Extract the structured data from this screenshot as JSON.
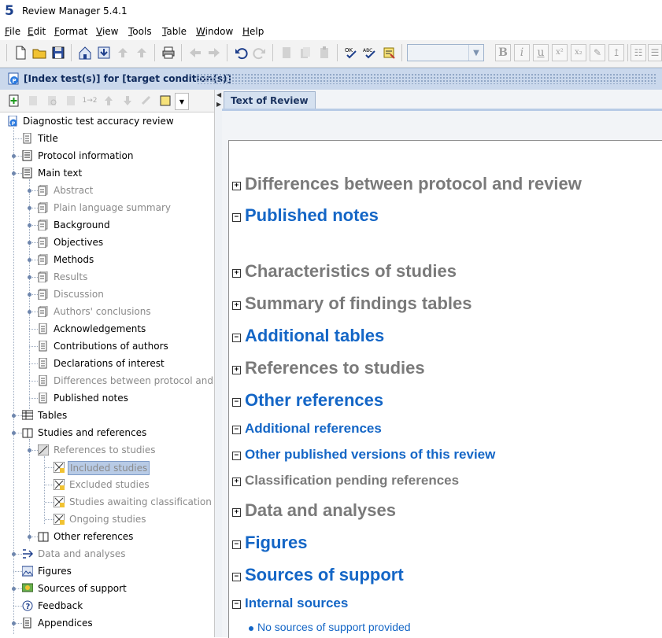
{
  "window": {
    "title": "Review Manager 5.4.1",
    "logo": "5"
  },
  "menu": [
    {
      "label": "File",
      "key": "F",
      "rest": "ile"
    },
    {
      "label": "Edit",
      "key": "E",
      "rest": "dit"
    },
    {
      "label": "Format",
      "key": "F",
      "rest": "ormat"
    },
    {
      "label": "View",
      "key": "V",
      "rest": "iew"
    },
    {
      "label": "Tools",
      "key": "T",
      "rest": "ools"
    },
    {
      "label": "Table",
      "key": "T",
      "rest": "able"
    },
    {
      "label": "Window",
      "key": "W",
      "rest": "indow"
    },
    {
      "label": "Help",
      "key": "H",
      "rest": "elp"
    }
  ],
  "toolbar": {
    "buttons": [
      "new-file-icon",
      "open-folder-icon",
      "save-icon",
      "home-icon",
      "download-icon",
      "upload-up-icon",
      "upload-icon",
      "print-icon",
      "back-arrow-icon",
      "forward-arrow-icon",
      "undo-icon",
      "redo-icon",
      "cut-icon",
      "copy-icon",
      "paste-icon",
      "spellcheck-ok-icon",
      "spellcheck-abc-icon",
      "notes-icon"
    ],
    "style_value": "",
    "format_buttons": [
      "B",
      "i",
      "u",
      "x²",
      "x₂",
      "✎",
      "↥"
    ]
  },
  "document": {
    "title": "[Index test(s)] for [target condition(s)]"
  },
  "tree": {
    "root": "Diagnostic test accuracy review",
    "items": [
      {
        "label": "Title",
        "dim": false
      },
      {
        "label": "Protocol information",
        "dim": false
      },
      {
        "label": "Main text",
        "dim": false
      },
      {
        "label": "Abstract",
        "dim": true
      },
      {
        "label": "Plain language summary",
        "dim": true
      },
      {
        "label": "Background",
        "dim": false
      },
      {
        "label": "Objectives",
        "dim": false
      },
      {
        "label": "Methods",
        "dim": false
      },
      {
        "label": "Results",
        "dim": true
      },
      {
        "label": "Discussion",
        "dim": true
      },
      {
        "label": "Authors' conclusions",
        "dim": true
      },
      {
        "label": "Acknowledgements",
        "dim": false
      },
      {
        "label": "Contributions of authors",
        "dim": false
      },
      {
        "label": "Declarations of interest",
        "dim": false
      },
      {
        "label": "Differences between protocol and review",
        "dim": true
      },
      {
        "label": "Published notes",
        "dim": false
      },
      {
        "label": "Tables",
        "dim": false
      },
      {
        "label": "Studies and references",
        "dim": false
      },
      {
        "label": "References to studies",
        "dim": true
      },
      {
        "label": "Included studies",
        "dim": true,
        "selected": true
      },
      {
        "label": "Excluded studies",
        "dim": true
      },
      {
        "label": "Studies awaiting classification",
        "dim": true
      },
      {
        "label": "Ongoing studies",
        "dim": true
      },
      {
        "label": "Other references",
        "dim": false
      },
      {
        "label": "Data and analyses",
        "dim": true
      },
      {
        "label": "Figures",
        "dim": false
      },
      {
        "label": "Sources of support",
        "dim": false
      },
      {
        "label": "Feedback",
        "dim": false
      },
      {
        "label": "Appendices",
        "dim": false
      }
    ]
  },
  "editor": {
    "tab": "Text of Review",
    "sections": [
      {
        "label": "Differences between protocol and review",
        "expanded": false,
        "size": "big",
        "active": false
      },
      {
        "label": "Published notes",
        "expanded": true,
        "size": "big",
        "active": true
      },
      {
        "label": "Characteristics of studies",
        "expanded": false,
        "size": "big",
        "active": false
      },
      {
        "label": "Summary of findings tables",
        "expanded": false,
        "size": "big",
        "active": false
      },
      {
        "label": "Additional tables",
        "expanded": true,
        "size": "big",
        "active": true
      },
      {
        "label": "References to studies",
        "expanded": false,
        "size": "big",
        "active": false
      },
      {
        "label": "Other references",
        "expanded": true,
        "size": "big",
        "active": true
      },
      {
        "label": "Additional references",
        "expanded": true,
        "size": "mid",
        "active": true
      },
      {
        "label": "Other published versions of this review",
        "expanded": true,
        "size": "mid",
        "active": true
      },
      {
        "label": "Classification pending references",
        "expanded": false,
        "size": "mid",
        "active": false
      },
      {
        "label": "Data and analyses",
        "expanded": false,
        "size": "big",
        "active": false
      },
      {
        "label": "Figures",
        "expanded": true,
        "size": "big",
        "active": true
      },
      {
        "label": "Sources of support",
        "expanded": true,
        "size": "big",
        "active": true
      },
      {
        "label": "Internal sources",
        "expanded": true,
        "size": "mid",
        "active": true
      }
    ],
    "bullet": "No sources of support provided"
  },
  "colors": {
    "accent_blue": "#1466c6",
    "inactive_gray": "#7a7a7a",
    "docbar": "#cad8ec"
  }
}
